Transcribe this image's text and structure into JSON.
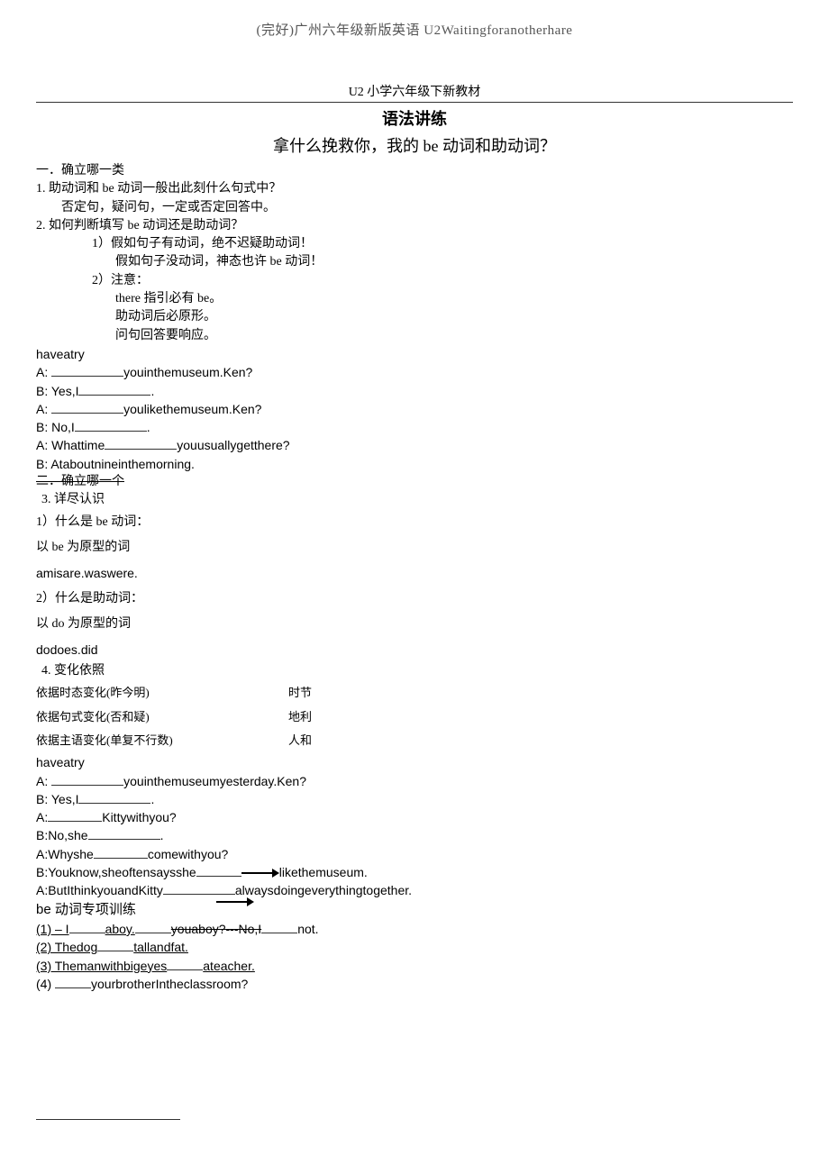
{
  "doc_header": "(完好)广州六年级新版英语 U2Waitingforanotherhare",
  "unit_title": "U2 小学六年级下新教材",
  "section_heading": "语法讲练",
  "topic_heading": "拿什么挽救你，我的 be 动词和助动词？",
  "block1_heading": "一．确立哪一类",
  "block1_q1": "1.    助动词和 be 动词一般出此刻什么句式中？",
  "block1_a1": "否定句，疑问句，一定或否定回答中。",
  "block1_q2": "2.    如何判断填写 be 动词还是助动词？",
  "block1_q2_1a": "1）假如句子有动词，绝不迟疑助动词！",
  "block1_q2_1b": "假如句子没动词，神态也许 be 动词！",
  "block1_q2_2": "2）注意：",
  "block1_q2_2a": "there 指引必有 be。",
  "block1_q2_2b": "助动词后必原形。",
  "block1_q2_2c": "问句回答要响应。",
  "try1_label": "haveatry",
  "try1_A1a": "A: ",
  "try1_A1b": "youinthemuseum.Ken?",
  "try1_B1": "B: Yes,I",
  "try1_B1b": ".",
  "try1_A2a": "A: ",
  "try1_A2b": "youlikethemuseum.Ken?",
  "try1_B2": "B: No,I",
  "try1_B2b": ".",
  "try1_A3a": "A: Whattime",
  "try1_A3b": "youusuallygetthere?",
  "try1_B3": "B: Ataboutnineinthemorning.",
  "block2_heading": "二．确立哪一个",
  "block2_q3": "3.  详尽认识",
  "block2_q3_1": "1）什么是 be 动词：",
  "block2_q3_1a": "以 be 为原型的词",
  "block2_q3_1b": "amisare.waswere.",
  "block2_q3_2": "2）什么是助动词：",
  "block2_q3_2a": "以 do 为原型的词",
  "block2_q3_2b": "dodoes.did",
  "block2_q4": "4.  变化依照",
  "block2_q4_rows": [
    {
      "left": "依据时态变化(昨今明)",
      "right": "时节"
    },
    {
      "left": "依据句式变化(否和疑)",
      "right": "地利"
    },
    {
      "left": "依据主语变化(单复不行数)",
      "right": "人和"
    }
  ],
  "try2_label": "haveatry",
  "try2_A1a": "A: ",
  "try2_A1b": "youinthemuseumyesterday.Ken?",
  "try2_B1": "B: Yes,I",
  "try2_B1b": ".",
  "try2_A2a": "A:",
  "try2_A2b": "Kittywithyou?",
  "try2_B2a": "B:No,she",
  "try2_B2b": ".",
  "try2_A3a": "A:Whyshe",
  "try2_A3b": "comewithyou?",
  "try2_B3a": "B:Youknow,sheoftensaysshe",
  "try2_B3b": "likethemuseum.",
  "try2_A4a": "A:ButIthinkyouandKitty",
  "try2_A4b": "alwaysdoingeverythingtogether.",
  "be_section_title": "be 动词专项训练",
  "be_items": {
    "i1a": "(1)   – I",
    "i1b": "aboy.",
    "i1c": "youaboy?---No,I",
    "i1d": "not.",
    "i2a": "(2)   Thedog",
    "i2b": "tallandfat.",
    "i3a": "(3)   Themanwithbigeyes",
    "i3b": "ateacher.",
    "i4a": "(4)   ",
    "i4b": "yourbrotherIntheclassroom?"
  }
}
